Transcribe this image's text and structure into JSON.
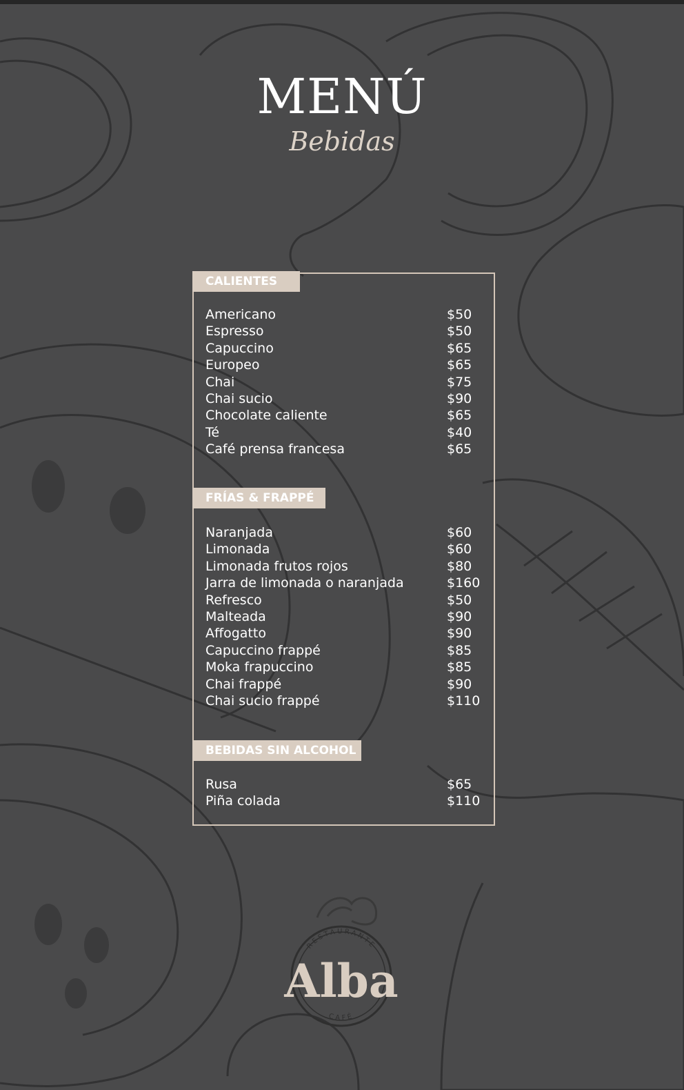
{
  "header": {
    "title": "MENÚ",
    "subtitle": "Bebidas"
  },
  "sections": [
    {
      "title": "CALIENTES",
      "items": [
        {
          "name": "Americano",
          "price": "$50"
        },
        {
          "name": "Espresso",
          "price": "$50"
        },
        {
          "name": "Capuccino",
          "price": "$65"
        },
        {
          "name": "Europeo",
          "price": "$65"
        },
        {
          "name": "Chai",
          "price": "$75"
        },
        {
          "name": "Chai sucio",
          "price": "$90"
        },
        {
          "name": "Chocolate caliente",
          "price": "$65"
        },
        {
          "name": "Té",
          "price": "$40"
        },
        {
          "name": "Café prensa francesa",
          "price": "$65"
        }
      ]
    },
    {
      "title": "FRÍAS & FRAPPÉ",
      "items": [
        {
          "name": "Naranjada",
          "price": "$60"
        },
        {
          "name": "Limonada",
          "price": "$60"
        },
        {
          "name": "Limonada frutos rojos",
          "price": "$80"
        },
        {
          "name": "Jarra de limonada o naranjada",
          "price": "$160"
        },
        {
          "name": "Refresco",
          "price": "$50"
        },
        {
          "name": "Malteada",
          "price": "$90"
        },
        {
          "name": "Affogatto",
          "price": "$90"
        },
        {
          "name": "Capuccino frappé",
          "price": "$85"
        },
        {
          "name": "Moka frapuccino",
          "price": "$85"
        },
        {
          "name": "Chai frappé",
          "price": "$90"
        },
        {
          "name": "Chai sucio frappé",
          "price": "$110"
        }
      ]
    },
    {
      "title": "BEBIDAS SIN ALCOHOL",
      "items": [
        {
          "name": "Rusa",
          "price": "$65"
        },
        {
          "name": "Piña colada",
          "price": "$110"
        }
      ]
    }
  ],
  "logo": {
    "name": "Alba",
    "top_text": "RESTAURANTE",
    "bottom_text": "CAFÉ"
  },
  "colors": {
    "background": "#4a4a4b",
    "accent": "#d9cdc1",
    "text": "#ffffff"
  },
  "icons": [
    "food-sketch-background",
    "leaf-icon"
  ]
}
